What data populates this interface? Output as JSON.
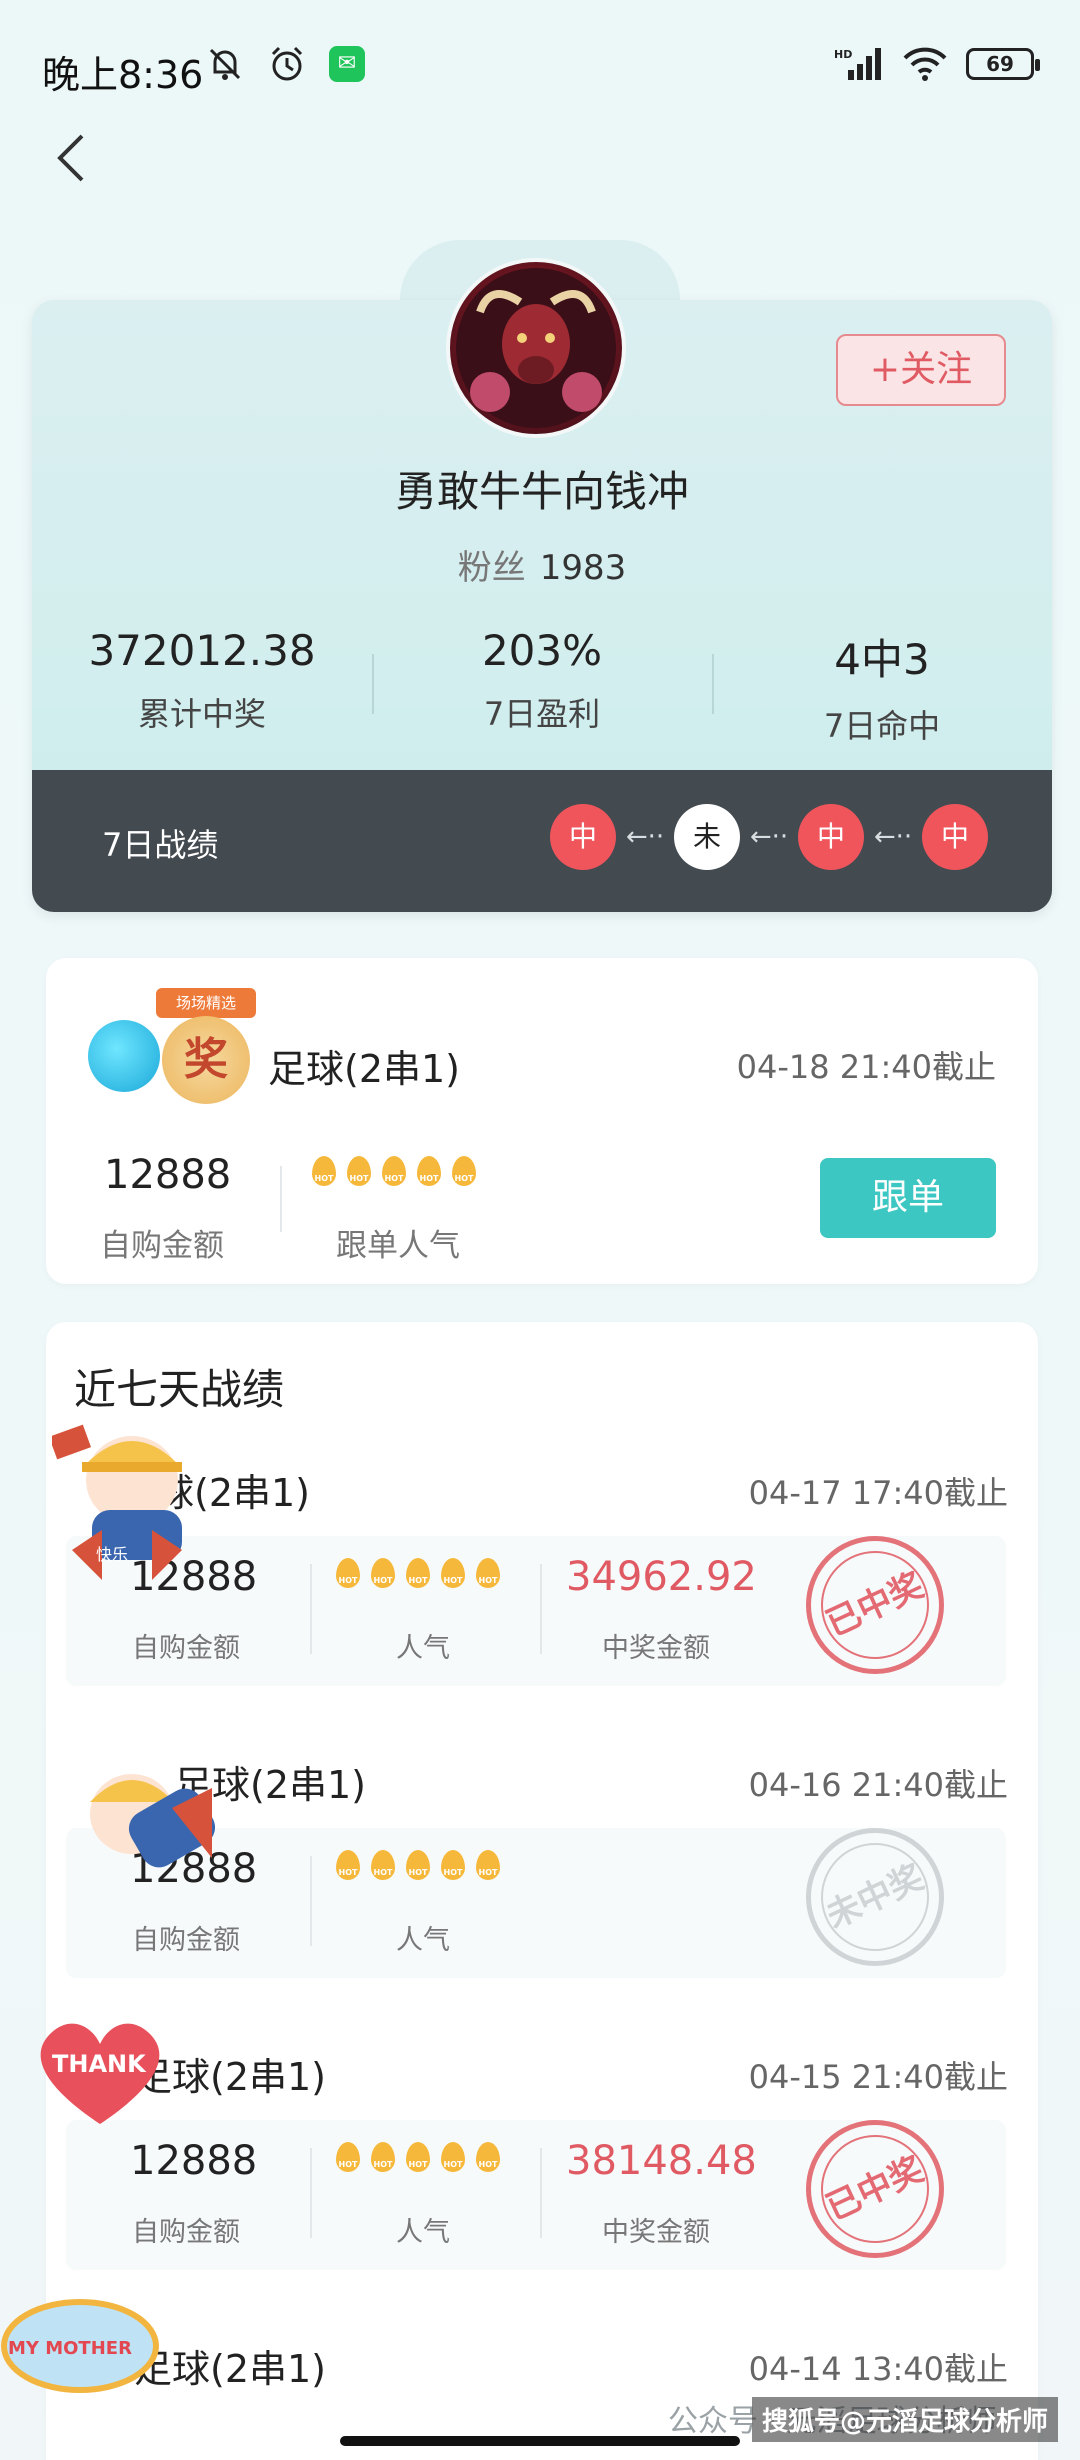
{
  "status_bar": {
    "time": "晚上8:36",
    "battery": "69"
  },
  "profile": {
    "follow_label": "+关注",
    "nickname": "勇敢牛牛向钱冲",
    "fans_label": "粉丝",
    "fans_count": "1983",
    "stats": [
      {
        "value": "372012.38",
        "label": "累计中奖"
      },
      {
        "value": "203%",
        "label": "7日盈利"
      },
      {
        "value": "4中3",
        "label": "7日命中"
      }
    ],
    "record": {
      "label": "7日战绩",
      "chain": [
        "中",
        "未",
        "中",
        "中"
      ]
    }
  },
  "current_play": {
    "badge_ribbon": "场场精选",
    "badge_char": "奖",
    "title": "足球(2串1)",
    "deadline": "04-18 21:40截止",
    "amount": "12888",
    "amount_label": "自购金额",
    "popularity_label": "跟单人气",
    "follow_button": "跟单"
  },
  "history": {
    "title": "近七天战绩",
    "items": [
      {
        "title": "球(2串1)",
        "deadline": "04-17 17:40截止",
        "amount": "12888",
        "amount_label": "自购金额",
        "popularity_label": "人气",
        "win_amount": "34962.92",
        "win_label": "中奖金额",
        "stamp": "已中奖",
        "won": true
      },
      {
        "title": "足球(2串1)",
        "deadline": "04-16 21:40截止",
        "amount": "12888",
        "amount_label": "自购金额",
        "popularity_label": "人气",
        "win_amount": "",
        "win_label": "",
        "stamp": "未中奖",
        "won": false
      },
      {
        "title": "足球(2串1)",
        "deadline": "04-15 21:40截止",
        "amount": "12888",
        "amount_label": "自购金额",
        "popularity_label": "人气",
        "win_amount": "38148.48",
        "win_label": "中奖金额",
        "stamp": "已中奖",
        "won": true
      },
      {
        "title": "足球(2串1)",
        "deadline": "04-14 13:40截止"
      }
    ]
  },
  "stickers": {
    "thank": "THANK",
    "my_mother": "MY MOTHER",
    "kuaile": "快乐"
  },
  "watermark": "公众号 · 元滔足球分析师",
  "sohu_mark": "搜狐号@元滔足球分析师",
  "colors": {
    "accent_teal": "#3cc7c2",
    "win_red": "#f0555c",
    "record_bar": "#434a50"
  }
}
